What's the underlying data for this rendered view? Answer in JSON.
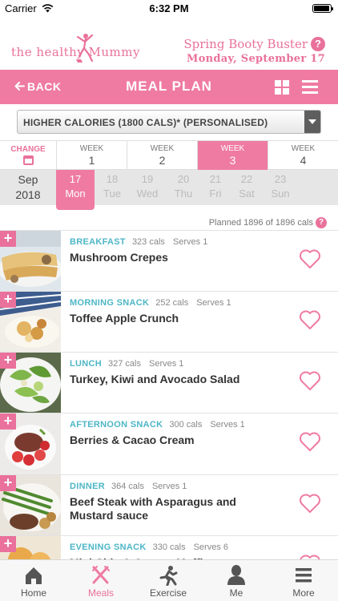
{
  "status_bar": {
    "carrier": "Carrier",
    "time": "6:32 PM",
    "battery_level": 0.95
  },
  "header": {
    "brand_text": "the healthy Mummy",
    "program_name": "Spring Booty Buster",
    "program_date": "Monday, September 17",
    "help_icon": "?"
  },
  "navbar": {
    "back_label": "BACK",
    "title": "MEAL PLAN"
  },
  "plan_select": {
    "selected": "HIGHER CALORIES (1800 CALS)* (PERSONALISED)"
  },
  "weeks": {
    "change_label": "CHANGE",
    "items": [
      {
        "label": "WEEK",
        "number": "1"
      },
      {
        "label": "WEEK",
        "number": "2"
      },
      {
        "label": "WEEK",
        "number": "3"
      },
      {
        "label": "WEEK",
        "number": "4"
      }
    ],
    "active_index": 2
  },
  "days": {
    "month": "Sep",
    "year": "2018",
    "items": [
      {
        "date": "17",
        "weekday": "Mon"
      },
      {
        "date": "18",
        "weekday": "Tue"
      },
      {
        "date": "19",
        "weekday": "Wed"
      },
      {
        "date": "20",
        "weekday": "Thu"
      },
      {
        "date": "21",
        "weekday": "Fri"
      },
      {
        "date": "22",
        "weekday": "Sat"
      },
      {
        "date": "23",
        "weekday": "Sun"
      }
    ],
    "active_index": 0
  },
  "planned": {
    "text": "Planned 1896 of 1896 cals",
    "help": "?"
  },
  "meals": [
    {
      "type": "BREAKFAST",
      "cals": "323 cals",
      "serves": "Serves 1",
      "title": "Mushroom Crepes",
      "plus": "+"
    },
    {
      "type": "MORNING SNACK",
      "cals": "252 cals",
      "serves": "Serves 1",
      "title": "Toffee Apple Crunch",
      "plus": "+"
    },
    {
      "type": "LUNCH",
      "cals": "327 cals",
      "serves": "Serves 1",
      "title": "Turkey, Kiwi and Avocado Salad",
      "plus": "+"
    },
    {
      "type": "AFTERNOON SNACK",
      "cals": "300 cals",
      "serves": "Serves 1",
      "title": "Berries & Cacao Cream",
      "plus": "+"
    },
    {
      "type": "DINNER",
      "cals": "364 cals",
      "serves": "Serves 1",
      "title": "Beef Steak with Asparagus and Mustard sauce",
      "plus": "+"
    },
    {
      "type": "EVENING SNACK",
      "cals": "330 cals",
      "serves": "Serves 6",
      "title": "Mini Chia & Orange Muffins",
      "plus": "+"
    }
  ],
  "tabs": [
    {
      "label": "Home",
      "icon": "home-icon"
    },
    {
      "label": "Meals",
      "icon": "cutlery-icon"
    },
    {
      "label": "Exercise",
      "icon": "running-icon"
    },
    {
      "label": "Me",
      "icon": "person-icon"
    },
    {
      "label": "More",
      "icon": "menu-icon"
    }
  ],
  "active_tab": 1,
  "colors": {
    "brand_pink": "#ef7ba3",
    "accent_teal": "#4db6c6"
  }
}
